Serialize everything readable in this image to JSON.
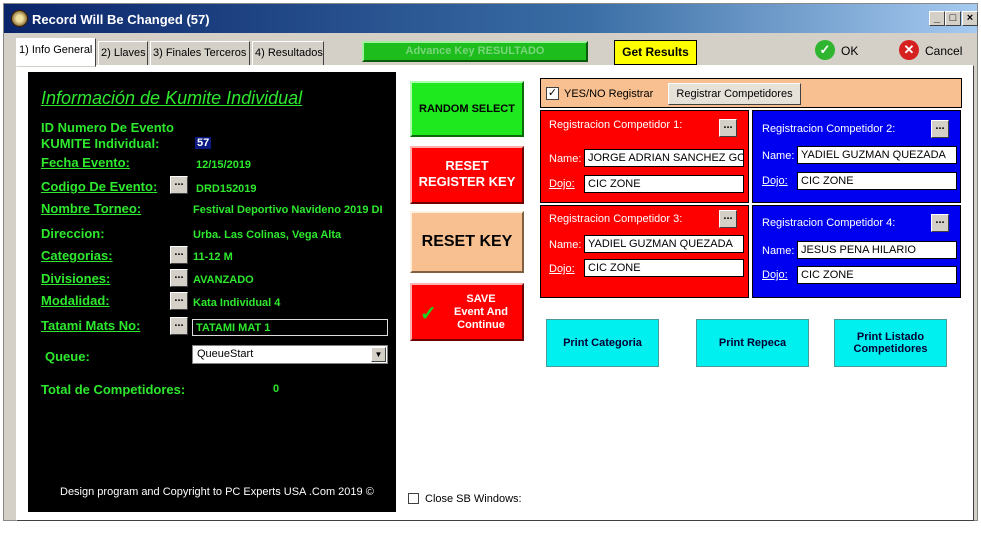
{
  "window": {
    "title": "Record Will Be Changed  (57)",
    "minimize": "_",
    "maximize": "□",
    "close": "×"
  },
  "tabs": [
    {
      "label": "1) Info General"
    },
    {
      "label": "2) Llaves"
    },
    {
      "label": "3) Finales Terceros"
    },
    {
      "label": "4) Resultados"
    }
  ],
  "toolbar": {
    "advance_key": "Advance Key RESULTADO",
    "get_results": "Get Results",
    "ok": "OK",
    "cancel": "Cancel"
  },
  "info": {
    "heading": "Información de Kumite Individual",
    "id_label_1": "ID Numero De Evento",
    "id_label_2": "KUMITE  Individual:",
    "id_value": "57",
    "fecha_label": "Fecha Evento:",
    "fecha_value": "12/15/2019",
    "codigo_label": "Codigo De Evento:",
    "codigo_value": "DRD152019",
    "torneo_label": "Nombre Torneo:",
    "torneo_value": "Festival Deportivo Navideno 2019 DI",
    "direccion_label": "Direccion:",
    "direccion_value": "Urba. Las Colinas, Vega Alta",
    "categorias_label": "Categorias:",
    "categorias_value": "11-12 M",
    "divisiones_label": "Divisiones:",
    "divisiones_value": "AVANZADO",
    "modalidad_label": "Modalidad:",
    "modalidad_value": "Kata Individual 4",
    "tatami_label": "Tatami Mats No:",
    "tatami_value": "TATAMI MAT 1",
    "queue_label": "Queue:",
    "queue_value": "QueueStart",
    "total_label": "Total de Competidores:",
    "total_value": "0",
    "copyright": "Design program and Copyright to PC Experts USA .Com 2019 ©",
    "dots": "..."
  },
  "actions": {
    "random_select": "RANDOM SELECT",
    "reset_register_1": "RESET",
    "reset_register_2": "REGISTER KEY",
    "reset_key": "RESET KEY",
    "save_1": "SAVE",
    "save_2": "Event And",
    "save_3": "Continue"
  },
  "registration": {
    "yes_no": "YES/NO Registrar",
    "registrar_btn": "Registrar Competidores",
    "name_label": "Name:",
    "dojo_label": "Dojo:",
    "competitors": [
      {
        "title": "Registracion Competidor 1:",
        "name": "JORGE ADRIAN SANCHEZ GO",
        "dojo": "CIC ZONE"
      },
      {
        "title": "Registracion Competidor 2:",
        "name": "YADIEL GUZMAN QUEZADA",
        "dojo": "CIC ZONE"
      },
      {
        "title": "Registracion Competidor 3:",
        "name": "YADIEL GUZMAN QUEZADA",
        "dojo": "CIC ZONE"
      },
      {
        "title": "Registracion Competidor 4:",
        "name": "JESUS PENA HILARIO",
        "dojo": "CIC ZONE"
      }
    ]
  },
  "print": {
    "categoria": "Print Categoria",
    "repeca": "Print Repeca",
    "listado_1": "Print Listado",
    "listado_2": "Competidores"
  },
  "footer": {
    "close_sb": "Close SB Windows:"
  },
  "colors": {
    "panel_green_text": "#2ee82e",
    "red": "#ff0000",
    "blue": "#0000f0",
    "cyan": "#00f0f0",
    "yellow": "#ffff00"
  }
}
